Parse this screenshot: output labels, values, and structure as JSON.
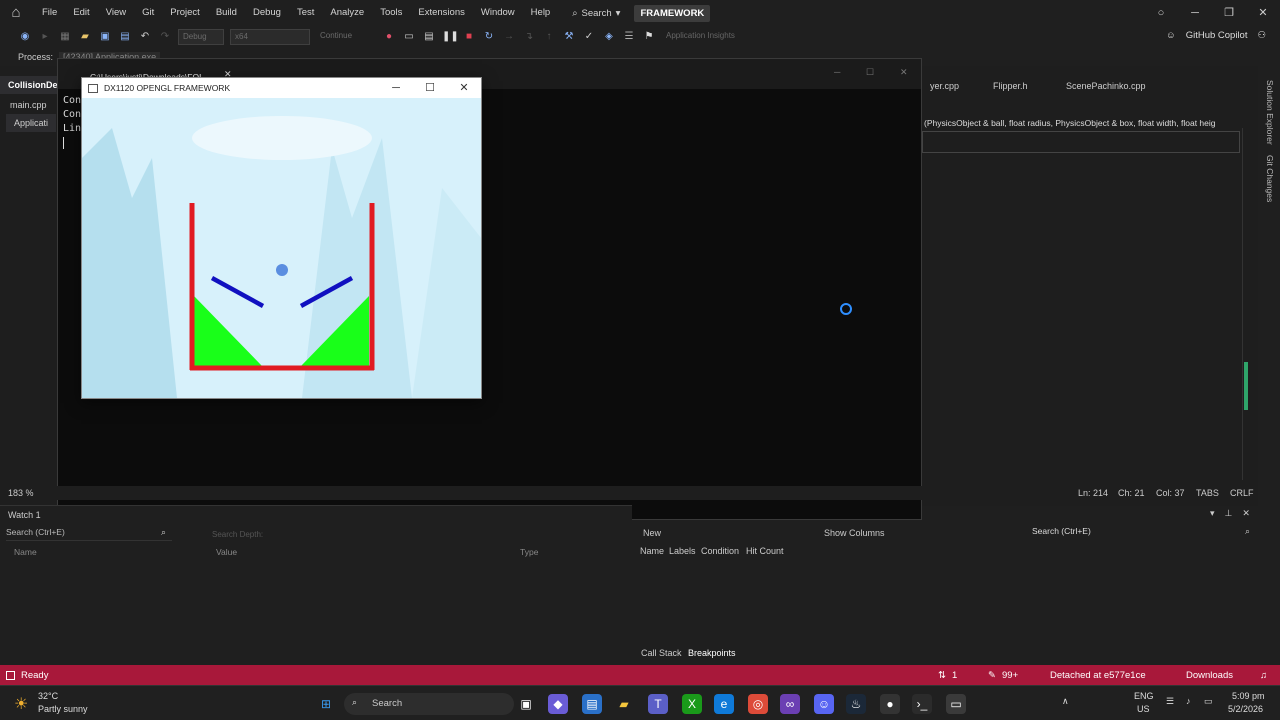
{
  "menubar": {
    "items": [
      "File",
      "Edit",
      "View",
      "Git",
      "Project",
      "Build",
      "Debug",
      "Test",
      "Analyze",
      "Tools",
      "Extensions",
      "Window",
      "Help"
    ],
    "search_label": "Search",
    "solution_name": "FRAMEWORK"
  },
  "toolbar": {
    "config": "Debug",
    "platform": "x64",
    "continue_label": "Continue",
    "app_insights": "Application Insights",
    "copilot_label": "GitHub Copilot"
  },
  "processbar": {
    "label": "Process:",
    "value": "[42340] Application.exe"
  },
  "tabs": {
    "left": "CollisionDe",
    "file": "main.cpp",
    "app": "Applicati",
    "right1": "yer.cpp",
    "right2": "Flipper.h",
    "right3": "ScenePachinko.cpp",
    "signature": "(PhysicsObject & ball, float radius, PhysicsObject & box, float width, float heig"
  },
  "side_tabs": {
    "solution_explorer": "Solution Explorer",
    "git_changes": "Git Changes"
  },
  "console": {
    "title": "C:\\Users\\justi\\Downloads\\FOL",
    "line1": "Con",
    "line2": "Con",
    "line3": "Lin"
  },
  "game_window": {
    "title": "DX1120 OPENGL FRAMEWORK",
    "colors": {
      "walls": "#e11b22",
      "flippers": "#1010c0",
      "ramps": "#19ff19",
      "ball": "#5a8ee0",
      "sky": "#d7f1fb"
    }
  },
  "editor_status": {
    "zoom": "183 %",
    "line": "Ln: 214",
    "char": "Ch: 21",
    "col": "Col: 37",
    "tabs": "TABS",
    "eol": "CRLF"
  },
  "watch": {
    "title": "Watch 1",
    "search_placeholder": "Search (Ctrl+E)",
    "search_depth_label": "Search Depth:",
    "columns": [
      "Name",
      "Value",
      "Type"
    ]
  },
  "breakpoints": {
    "new_label": "New",
    "show_columns": "Show Columns",
    "search_placeholder": "Search (Ctrl+E)",
    "columns": [
      "Name",
      "Labels",
      "Condition",
      "Hit Count"
    ],
    "tab_callstack": "Call Stack",
    "tab_breakpoints": "Breakpoints"
  },
  "statusbar": {
    "ready": "Ready",
    "errors": "1",
    "changes": "99+",
    "git_status": "Detached at e577e1ce",
    "downloads": "Downloads"
  },
  "taskbar": {
    "weather_temp": "32°C",
    "weather_desc": "Partly sunny",
    "search_label": "Search",
    "lang_top": "ENG",
    "lang_bottom": "US",
    "time": "5:09 pm",
    "date": "5/2/2026"
  }
}
